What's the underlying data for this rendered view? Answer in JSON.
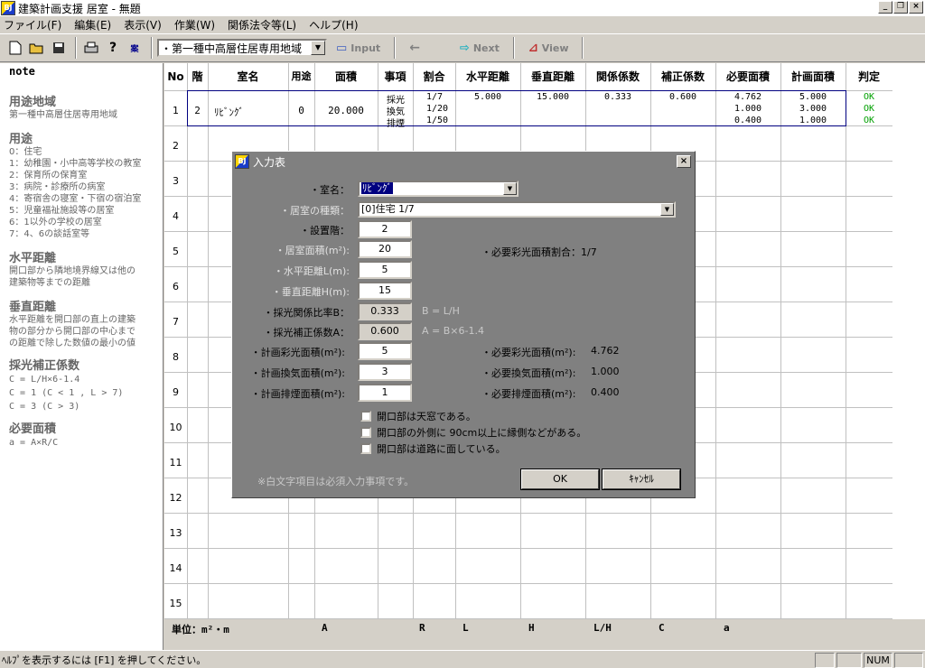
{
  "window": {
    "title": "建築計画支援 居室 - 無題",
    "min": "_",
    "max": "❐",
    "close": "×"
  },
  "menu": [
    "ファイル(F)",
    "編集(E)",
    "表示(V)",
    "作業(W)",
    "関係法令等(L)",
    "ヘルプ(H)"
  ],
  "toolbar": {
    "zone_select": "・第一種中高層住居専用地域",
    "input_label": "Input",
    "back_label": "←",
    "next_label": "Next",
    "view_label": "View"
  },
  "note": {
    "title": "note",
    "sections": [
      {
        "head": "用途地域",
        "lines": [
          "第一種中高層住居専用地域"
        ]
      },
      {
        "head": "用途",
        "lines": [
          "0：住宅",
          "1：幼稚園・小中高等学校の教室",
          "2：保育所の保育室",
          "3：病院・診療所の病室",
          "4：寄宿舎の寝室・下宿の宿泊室",
          "5：児童福祉施設等の居室",
          "6：1以外の学校の居室",
          "7：4、6の談話室等"
        ]
      },
      {
        "head": "水平距離",
        "lines": [
          "開口部から隣地境界線又は他の",
          "建築物等までの距離"
        ]
      },
      {
        "head": "垂直距離",
        "lines": [
          "水平距離を開口部の直上の建築",
          "物の部分から開口部の中心まで",
          "の距離で除した数値の最小の値"
        ]
      },
      {
        "head": "採光補正係数",
        "mono": [
          "C = L/H×6-1.4",
          "C = 1 (C < 1 , L > 7)",
          "C = 3 (C > 3)"
        ]
      },
      {
        "head": "必要面積",
        "mono": [
          "a = A×R/C"
        ]
      }
    ]
  },
  "grid": {
    "headers": [
      "No",
      "階",
      "室名",
      "用途",
      "面積",
      "事項",
      "割合",
      "水平距離",
      "垂直距離",
      "関係係数",
      "補正係数",
      "必要面積",
      "計画面積",
      "判定"
    ],
    "rows": [
      "1",
      "2",
      "3",
      "4",
      "5",
      "6",
      "7",
      "8",
      "9",
      "10",
      "11",
      "12",
      "13",
      "14",
      "15"
    ],
    "row1": {
      "floor": "2",
      "room": "ﾘﾋﾞﾝｸﾞ",
      "use": "0",
      "area": "20.000",
      "items": [
        "採光",
        "換気",
        "排煙"
      ],
      "ratios": [
        "1/7",
        "1/20",
        "1/50"
      ],
      "hdist": "5.000",
      "vdist": "15.000",
      "coef": "0.333",
      "corr": "0.600",
      "req": [
        "4.762",
        "1.000",
        "0.400"
      ],
      "plan": [
        "5.000",
        "3.000",
        "1.000"
      ],
      "judge": [
        "OK",
        "OK",
        "OK"
      ]
    }
  },
  "units": {
    "label": "単位：m²・m",
    "A": "A",
    "R": "R",
    "L": "L",
    "H": "H",
    "LH": "L/H",
    "C": "C",
    "a": "a"
  },
  "status": {
    "text": "ﾍﾙﾌﾟを表示するには [F1] を押してください。",
    "num": "NUM"
  },
  "dialog": {
    "title": "入力表",
    "room_name_label": "・室名：",
    "room_name": "ﾘﾋﾞﾝｸﾞ",
    "room_type_label": "・居室の種類：",
    "room_type": "[0]住宅 1/7",
    "floor_label": "・設置階：",
    "floor": "2",
    "area_label": "・居室面積(m²):",
    "area": "20",
    "hdist_label": "・水平距離L(m):",
    "hdist": "5",
    "vdist_label": "・垂直距離H(m):",
    "vdist": "15",
    "b_label": "・採光関係比率B：",
    "b": "0.333",
    "b_formula": "B = L/H",
    "a_label": "・採光補正係数A：",
    "a": "0.600",
    "a_formula": "A = B×6-1.4",
    "req_ratio": "・必要彩光面積割合：1/7",
    "plan_light_label": "・計画彩光面積(m²):",
    "plan_light": "5",
    "plan_vent_label": "・計画換気面積(m²):",
    "plan_vent": "3",
    "plan_smoke_label": "・計画排煙面積(m²):",
    "plan_smoke": "1",
    "req_light": "・必要彩光面積(m²):",
    "req_light_v": "4.762",
    "req_vent": "・必要換気面積(m²):",
    "req_vent_v": "1.000",
    "req_smoke": "・必要排煙面積(m²):",
    "req_smoke_v": "0.400",
    "chk1": "開口部は天窓である。",
    "chk2": "開口部の外側に 90cm以上に縁側などがある。",
    "chk3": "開口部は道路に面している。",
    "note": "※白文字項目は必須入力事項です。",
    "ok": "OK",
    "cancel": "ｷｬﾝｾﾙ"
  }
}
